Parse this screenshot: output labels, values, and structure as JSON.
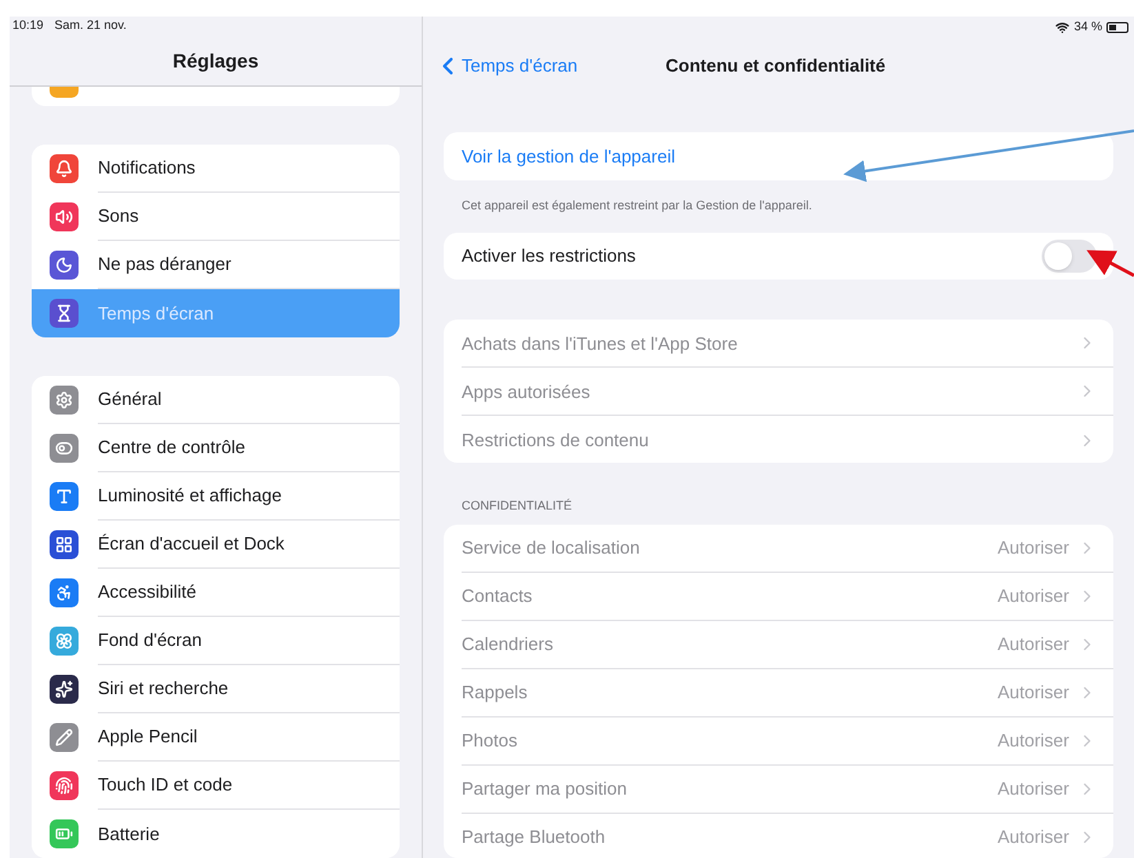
{
  "status_bar": {
    "time": "10:19",
    "date": "Sam. 21 nov.",
    "battery": "34 %"
  },
  "sidebar": {
    "title": "Réglages",
    "groups": [
      [
        {
          "label": "Notifications",
          "color": "#f0453a",
          "selected": false
        },
        {
          "label": "Sons",
          "color": "#f0365a",
          "selected": false
        },
        {
          "label": "Ne pas déranger",
          "color": "#5a56d6",
          "selected": false
        },
        {
          "label": "Temps d'écran",
          "color": "#5a4fcf",
          "selected": true
        }
      ],
      [
        {
          "label": "Général",
          "color": "#8e8e93",
          "selected": false
        },
        {
          "label": "Centre de contrôle",
          "color": "#8e8e93",
          "selected": false
        },
        {
          "label": "Luminosité et affichage",
          "color": "#1a7cf5",
          "selected": false
        },
        {
          "label": "Écran d'accueil et Dock",
          "color": "#2a4fd6",
          "selected": false
        },
        {
          "label": "Accessibilité",
          "color": "#1a7cf5",
          "selected": false
        },
        {
          "label": "Fond d'écran",
          "color": "#35aadc",
          "selected": false
        },
        {
          "label": "Siri et recherche",
          "color": "#2a2a4a",
          "selected": false
        },
        {
          "label": "Apple Pencil",
          "color": "#8e8e93",
          "selected": false
        },
        {
          "label": "Touch ID et code",
          "color": "#f0365a",
          "selected": false
        },
        {
          "label": "Batterie",
          "color": "#34c759",
          "selected": false
        }
      ]
    ]
  },
  "nav": {
    "back": "Temps d'écran",
    "title": "Contenu et confidentialité"
  },
  "device_management": {
    "link": "Voir la gestion de l'appareil",
    "footer": "Cet appareil est également restreint par la Gestion de l'appareil."
  },
  "restrictions": {
    "label": "Activer les restrictions",
    "on": false
  },
  "content_rows": [
    {
      "label": "Achats dans l'iTunes et l'App Store",
      "disabled": true
    },
    {
      "label": "Apps autorisées",
      "disabled": true
    },
    {
      "label": "Restrictions de contenu",
      "disabled": true
    }
  ],
  "privacy": {
    "header": "CONFIDENTIALITÉ",
    "rows": [
      {
        "label": "Service de localisation",
        "value": "Autoriser",
        "disabled": true
      },
      {
        "label": "Contacts",
        "value": "Autoriser",
        "disabled": true
      },
      {
        "label": "Calendriers",
        "value": "Autoriser",
        "disabled": true
      },
      {
        "label": "Rappels",
        "value": "Autoriser",
        "disabled": true
      },
      {
        "label": "Photos",
        "value": "Autoriser",
        "disabled": true
      },
      {
        "label": "Partager ma position",
        "value": "Autoriser",
        "disabled": true
      },
      {
        "label": "Partage Bluetooth",
        "value": "Autoriser",
        "disabled": true
      }
    ]
  }
}
